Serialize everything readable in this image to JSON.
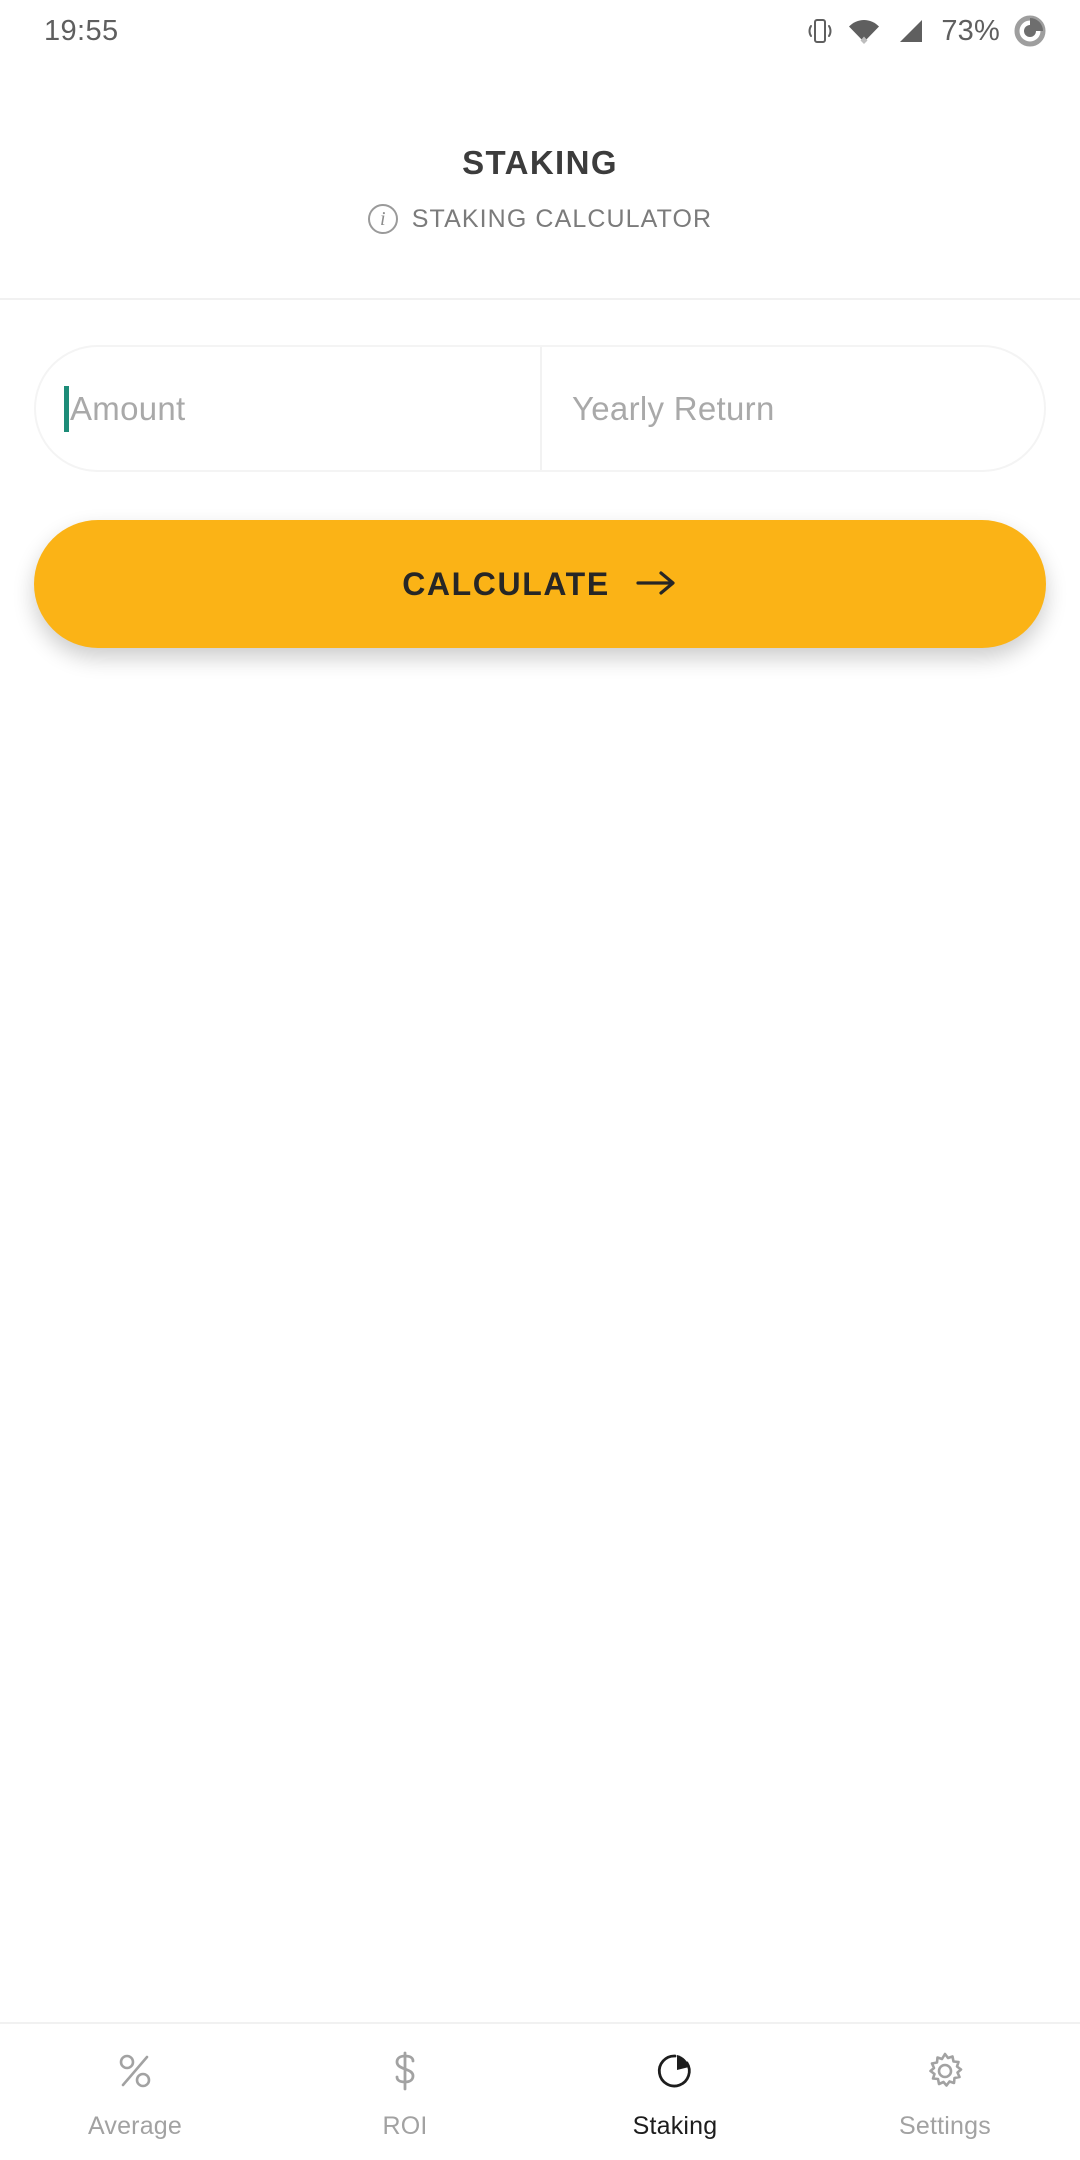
{
  "status_bar": {
    "time": "19:55",
    "battery_percent": "73%",
    "icons": [
      "vibrate-icon",
      "wifi-icon",
      "cellular-signal-icon",
      "battery-circle-icon"
    ]
  },
  "header": {
    "title": "STAKING",
    "subtitle": "STAKING CALCULATOR",
    "info_glyph": "i",
    "info_icon_name": "info-icon"
  },
  "form": {
    "amount_field": {
      "placeholder": "Amount",
      "value": "",
      "focused": true
    },
    "yearly_return_field": {
      "placeholder": "Yearly Return",
      "value": "",
      "focused": false
    },
    "calculate_button": {
      "label": "CALCULATE",
      "icon": "arrow-right-icon"
    }
  },
  "bottom_nav": {
    "items": [
      {
        "label": "Average",
        "icon": "percent-icon",
        "active": false
      },
      {
        "label": "ROI",
        "icon": "dollar-icon",
        "active": false
      },
      {
        "label": "Staking",
        "icon": "pie-chart-icon",
        "active": true
      },
      {
        "label": "Settings",
        "icon": "gear-icon",
        "active": false
      }
    ]
  },
  "colors": {
    "accent_amber": "#fbb316",
    "caret_teal": "#1d8c78",
    "text_dark": "#3c3c3c",
    "text_muted": "#a2a2a2",
    "placeholder": "#a9a9a9",
    "divider": "#f1f1f1",
    "background": "#ffffff"
  }
}
